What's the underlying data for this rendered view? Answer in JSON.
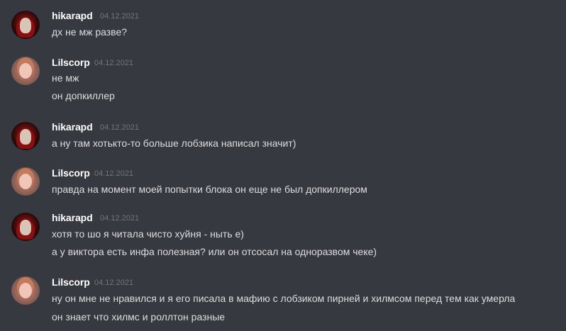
{
  "messages": [
    {
      "username": "hikarapd",
      "timestamp": "04.12.2021",
      "lines": [
        "дх не мж разве?"
      ]
    },
    {
      "username": "Lilscorp",
      "timestamp": "04.12.2021",
      "lines": [
        "не мж",
        "он допкиллер"
      ]
    },
    {
      "username": "hikarapd",
      "timestamp": "04.12.2021",
      "lines": [
        "а ну там хотькто-то больше лобзика написал значит)"
      ]
    },
    {
      "username": "Lilscorp",
      "timestamp": "04.12.2021",
      "lines": [
        "правда на момент моей попытки блока он еще не был допкиллером"
      ]
    },
    {
      "username": "hikarapd",
      "timestamp": "04.12.2021",
      "lines": [
        "хотя то шо я читала чисто хуйня - ныть е)",
        "а у виктора есть инфа полезная? или он отсосал на одноразвом чеке)"
      ]
    },
    {
      "username": "Lilscorp",
      "timestamp": "04.12.2021",
      "lines": [
        "ну он мне не нравился и я его писала в мафию с лобзиком пирней и хилмсом перед тем как умерла",
        "он знает что хилмс и роллтон разные"
      ]
    }
  ]
}
